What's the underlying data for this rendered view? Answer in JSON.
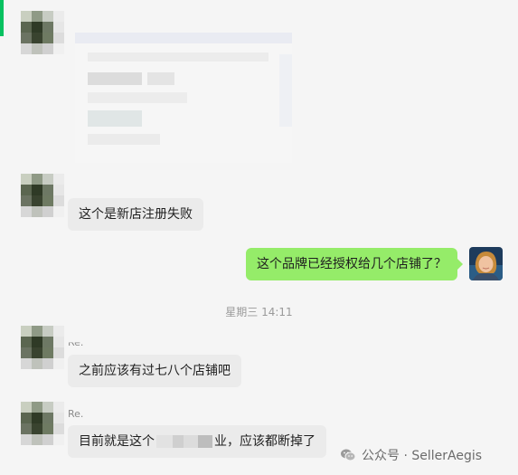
{
  "colors": {
    "accent": "#07c160",
    "bubble_self": "#95ec69",
    "bubble_other": "#ebebeb"
  },
  "chat": {
    "messages": [
      {
        "side": "left",
        "type": "image",
        "content": "blurred-image"
      },
      {
        "side": "left",
        "type": "text",
        "text": "这个是新店注册失败"
      },
      {
        "side": "right",
        "type": "text",
        "text": "这个品牌已经授权给几个店铺了？"
      },
      {
        "type": "timestamp",
        "text": "星期三 14:11"
      },
      {
        "side": "left",
        "type": "text",
        "sender": "Re.",
        "text": "之前应该有过七八个店铺吧"
      },
      {
        "side": "left",
        "type": "text",
        "sender": "Re.",
        "text_before": "目前就是这个",
        "text_after": "业，应该都断掉了"
      }
    ]
  },
  "watermark": {
    "icon": "wechat-icon",
    "text": "公众号 · SellerAegis"
  }
}
